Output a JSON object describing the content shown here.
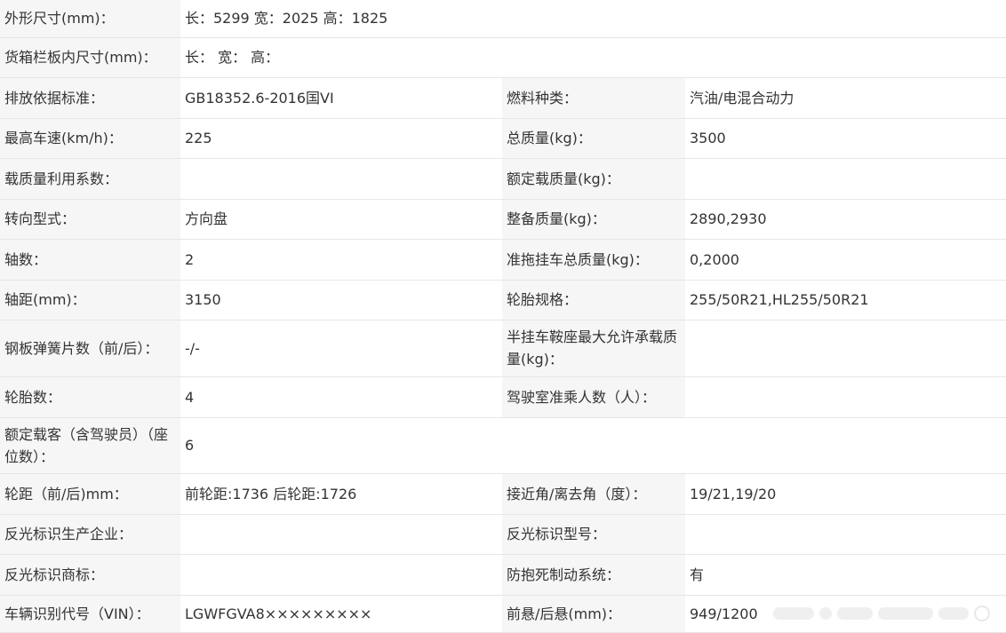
{
  "rows": [
    {
      "label": "外形尺寸(mm)：",
      "value": "长：5299 宽：2025 高：1825"
    },
    {
      "label": "货箱栏板内尺寸(mm)：",
      "value": "长： 宽： 高："
    },
    {
      "label": "排放依据标准：",
      "value": "GB18352.6-2016国VI",
      "label2": "燃料种类：",
      "value2": "汽油/电混合动力"
    },
    {
      "label": "最高车速(km/h)：",
      "value": "225",
      "label2": "总质量(kg)：",
      "value2": "3500"
    },
    {
      "label": "载质量利用系数：",
      "value": "",
      "label2": "额定载质量(kg)：",
      "value2": ""
    },
    {
      "label": "转向型式：",
      "value": "方向盘",
      "label2": "整备质量(kg)：",
      "value2": "2890,2930"
    },
    {
      "label": "轴数：",
      "value": "2",
      "label2": "准拖挂车总质量(kg)：",
      "value2": "0,2000"
    },
    {
      "label": "轴距(mm)：",
      "value": "3150",
      "label2": "轮胎规格：",
      "value2": "255/50R21,HL255/50R21"
    },
    {
      "label": "钢板弹簧片数（前/后）：",
      "value": "-/-",
      "label2": "半挂车鞍座最大允许承载质量(kg)：",
      "value2": ""
    },
    {
      "label": "轮胎数：",
      "value": "4",
      "label2": "驾驶室准乘人数（人）：",
      "value2": ""
    },
    {
      "label": "额定载客（含驾驶员）（座位数）：",
      "value": "6"
    },
    {
      "label": "轮距（前/后)mm：",
      "value": "前轮距:1736 后轮距:1726",
      "label2": "接近角/离去角（度）：",
      "value2": "19/21,19/20"
    },
    {
      "label": "反光标识生产企业：",
      "value": "",
      "label2": "反光标识型号：",
      "value2": ""
    },
    {
      "label": "反光标识商标：",
      "value": "",
      "label2": "防抱死制动系统：",
      "value2": "有"
    },
    {
      "label": "车辆识别代号（VIN）：",
      "value": "LGWFGVA8×××××××××",
      "label2": "前悬/后悬(mm)：",
      "value2": "949/1200"
    }
  ]
}
